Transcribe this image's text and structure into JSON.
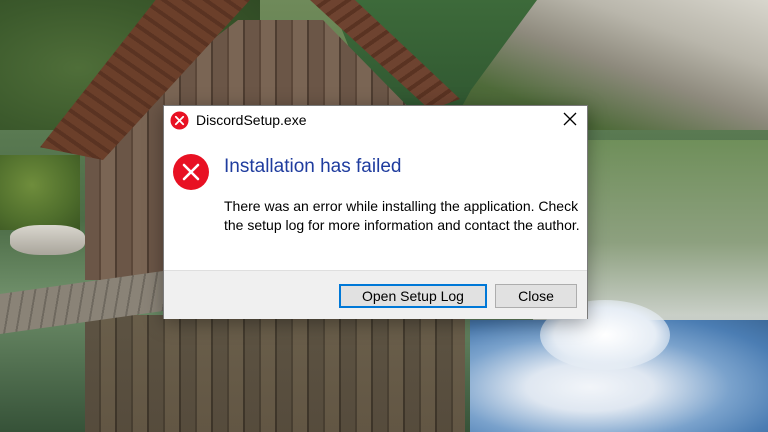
{
  "dialog": {
    "title": "DiscordSetup.exe",
    "heading": "Installation has failed",
    "message": "There was an error while installing the application. Check the setup log for more information and contact the author.",
    "buttons": {
      "primary": "Open Setup Log",
      "close": "Close"
    },
    "icons": {
      "title": "error-icon",
      "main": "error-icon",
      "close": "close-icon"
    },
    "colors": {
      "error_red": "#e81123",
      "heading_blue": "#1f3c9e",
      "focus_border": "#0078d7"
    }
  }
}
